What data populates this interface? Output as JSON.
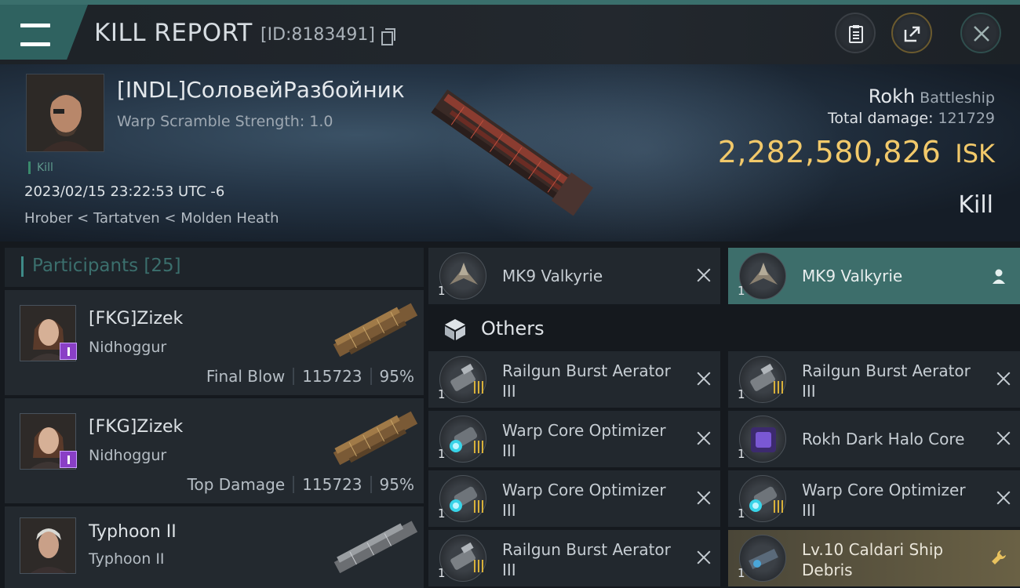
{
  "header": {
    "title": "KILL REPORT",
    "report_id": "[ID:8183491]"
  },
  "victim": {
    "name": "[INDL]СоловейРазбойник",
    "warp_scramble": "Warp Scramble Strength: 1.0",
    "tag": "Kill",
    "timestamp": "2023/02/15 23:22:53 UTC -6",
    "location": "Hrober < Tartatven < Molden Heath",
    "ship_name": "Rokh",
    "ship_class": "Battleship",
    "total_damage_label": "Total damage:",
    "total_damage": "121729",
    "isk_value": "2,282,580,826",
    "isk_unit": "ISK",
    "result": "Kill"
  },
  "participants": {
    "title": "Participants",
    "count": "[25]",
    "rows": [
      {
        "pilot": "[FKG]Zizek",
        "ship": "Nidhoggur",
        "role": "Final Blow",
        "damage": "115723",
        "percent": "95%"
      },
      {
        "pilot": "[FKG]Zizek",
        "ship": "Nidhoggur",
        "role": "Top Damage",
        "damage": "115723",
        "percent": "95%"
      },
      {
        "pilot": "Typhoon II",
        "ship": "Typhoon II"
      }
    ]
  },
  "items": {
    "drones": [
      {
        "name": "MK9  Valkyrie",
        "qty": "1"
      },
      {
        "name": "MK9  Valkyrie",
        "qty": "1"
      }
    ],
    "others_label": "Others",
    "others": [
      {
        "name": "Railgun Burst Aerator",
        "tier": "III",
        "qty": "1"
      },
      {
        "name": "Railgun Burst Aerator",
        "tier": "III",
        "qty": "1"
      },
      {
        "name": "Warp Core Optimizer",
        "tier": "III",
        "qty": "1"
      },
      {
        "name": "Rokh Dark Halo Core",
        "qty": "1"
      },
      {
        "name": "Warp Core Optimizer",
        "tier": "III",
        "qty": "1"
      },
      {
        "name": "Warp Core Optimizer",
        "tier": "III",
        "qty": "1"
      },
      {
        "name": "Railgun Burst Aerator",
        "tier": "III",
        "qty": "1"
      },
      {
        "name": "Lv.10 Caldari Ship",
        "tier": "Debris",
        "qty": "1"
      }
    ]
  },
  "colors": {
    "accent_teal": "#3d6e6b",
    "isk_gold": "#f2c96a",
    "corp_badge": "#8a3fc6"
  }
}
